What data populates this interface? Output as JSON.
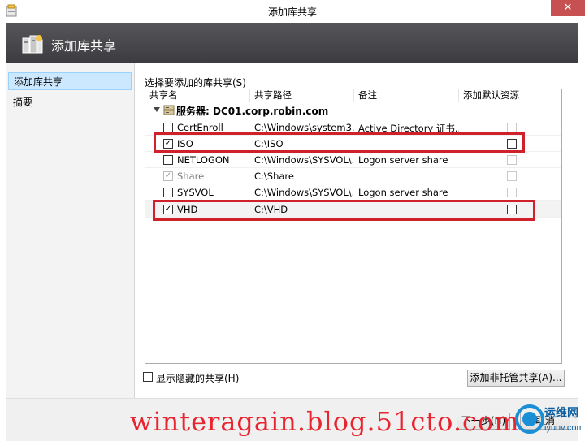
{
  "window": {
    "title": "添加库共享",
    "close_glyph": "✕"
  },
  "banner": {
    "title": "添加库共享",
    "icon": "library-share-icon"
  },
  "nav": {
    "items": [
      {
        "label": "添加库共享",
        "active": true
      },
      {
        "label": "摘要",
        "active": false
      }
    ]
  },
  "main": {
    "section_label": "选择要添加的库共享(S)",
    "columns": [
      "共享名",
      "共享路径",
      "备注",
      "添加默认资源"
    ],
    "group": {
      "label": "服务器: DC01.corp.robin.com",
      "icon": "server-icon"
    },
    "rows": [
      {
        "name": "CertEnroll",
        "path": "C:\\Windows\\system3...",
        "description": "Active Directory 证书...",
        "checked": false,
        "disabled": false
      },
      {
        "name": "ISO",
        "path": "C:\\ISO",
        "description": "",
        "checked": true,
        "disabled": false
      },
      {
        "name": "NETLOGON",
        "path": "C:\\Windows\\SYSVOL\\...",
        "description": "Logon server share",
        "checked": false,
        "disabled": false
      },
      {
        "name": "Share",
        "path": "C:\\Share",
        "description": "",
        "checked": true,
        "disabled": true
      },
      {
        "name": "SYSVOL",
        "path": "C:\\Windows\\SYSVOL\\...",
        "description": "Logon server share",
        "checked": false,
        "disabled": false
      },
      {
        "name": "VHD",
        "path": "C:\\VHD",
        "description": "",
        "checked": true,
        "disabled": false
      }
    ],
    "show_hidden_label": "显示隐藏的共享(H)",
    "add_unmanaged_label": "添加非托管共享(A)..."
  },
  "footer": {
    "next_label": "下一步(N)",
    "cancel_label": "取消"
  },
  "overlays": {
    "watermark": "winteragain.blog.51cto.com",
    "logo_text": "运维网",
    "logo_sub": "iyunv.com"
  },
  "colors": {
    "highlight": "#d0202a",
    "banner": "#4a4a4e",
    "selection": "#cce8ff"
  }
}
